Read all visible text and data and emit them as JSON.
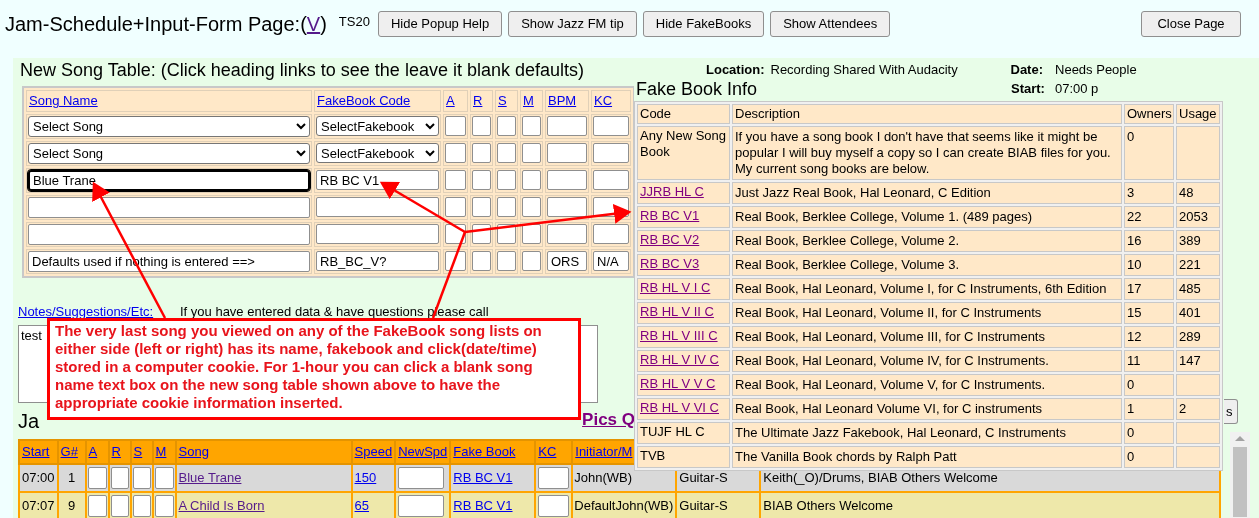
{
  "page": {
    "title": "Jam-Schedule+Input-Form Page:(",
    "title_link": "V",
    "title_end": ")",
    "version": "TS20"
  },
  "toolbar": {
    "buttons": [
      "Hide Popup Help",
      "Show Jazz FM tip",
      "Hide FakeBooks",
      "Show Attendees"
    ],
    "close_button": "Close Page"
  },
  "new_song_table": {
    "title": "New Song Table: (Click heading links to see the leave it blank defaults)",
    "columns": [
      "Song Name",
      "FakeBook Code",
      "A",
      "R",
      "S",
      "M",
      "BPM",
      "KC"
    ],
    "rows": [
      {
        "kind": "select",
        "song": "Select Song",
        "fakebook": "SelectFakebook",
        "focused": false
      },
      {
        "kind": "select",
        "song": "Select Song",
        "fakebook": "SelectFakebook",
        "focused": false
      },
      {
        "kind": "input",
        "song": "Blue Trane",
        "fakebook": "RB BC V1",
        "focused": true
      },
      {
        "kind": "input",
        "focused": false
      },
      {
        "kind": "input",
        "focused": false
      },
      {
        "kind": "input",
        "song": "Defaults used if nothing is entered ==>",
        "fakebook": "RB_BC_V?",
        "bpm": "ORS",
        "kc": "N/A",
        "focused": false
      }
    ]
  },
  "notes": {
    "link": "Notes/Suggestions/Etc:",
    "hint": "If you have entered data & have questions please call",
    "value": "test"
  },
  "popup_help": {
    "text": "The very last song you viewed on any of the FakeBook song lists on either side (left or right) has its name, fakebook and click(date/time) stored in a computer cookie. For 1-hour you can click a blank song name text box on the new song table shown above to have the appropriate cookie information inserted."
  },
  "schedule": {
    "heading": "Ja",
    "pics_link": "Pics Q",
    "partial_button": "s",
    "columns": [
      "Start",
      "G#",
      "A",
      "R",
      "S",
      "M",
      "Song",
      "Speed",
      "NewSpd",
      "Fake Book",
      "KC",
      "Initiator/M"
    ],
    "rows": [
      {
        "start": "07:00",
        "number": "1",
        "song": "Blue Trane",
        "speed": "150",
        "fake_book": "RB BC V1",
        "initiator": "John(WB)",
        "instrument": "Guitar-S",
        "notes": "Keith(_O)/Drums, BIAB Others Welcome",
        "color": "#d9d9d9"
      },
      {
        "start": "07:07",
        "number": "9",
        "song": "A Child Is Born",
        "speed": "65",
        "fake_book": "RB BC V1",
        "initiator": "DefaultJohn(WB)",
        "instrument": "Guitar-S",
        "notes": "BIAB Others Welcome",
        "color": "#eee8aa"
      }
    ]
  },
  "fake_book_info": {
    "location_label": "Location:",
    "location": "Recording Shared With Audacity",
    "date_label": "Date:",
    "date": "Needs People",
    "start_label": "Start:",
    "start": "07:00 p",
    "title": "Fake Book Info",
    "columns": [
      "Code",
      "Description",
      "Owners",
      "Usage"
    ],
    "rows": [
      {
        "code": "Any New Song Book",
        "link": false,
        "description": "If you have a song book I don't have that seems like it might be popular I will buy myself a copy so I can create BIAB files for you. My current song books are below.",
        "owners": "0"
      },
      {
        "code": "JJRB HL C",
        "link": true,
        "description": "Just Jazz Real Book, Hal Leonard, C Edition",
        "owners": "3",
        "usage": "48"
      },
      {
        "code": "RB BC V1",
        "link": true,
        "description": "Real Book, Berklee College, Volume 1. (489 pages)",
        "owners": "22",
        "usage": "2053"
      },
      {
        "code": "RB BC V2",
        "link": true,
        "description": "Real Book, Berklee College, Volume 2.",
        "owners": "16",
        "usage": "389"
      },
      {
        "code": "RB BC V3",
        "link": true,
        "description": "Real Book, Berklee College, Volume 3.",
        "owners": "10",
        "usage": "221"
      },
      {
        "code": "RB HL V I C",
        "link": true,
        "description": "Real Book, Hal Leonard, Volume I, for C Instruments, 6th Edition",
        "owners": "17",
        "usage": "485"
      },
      {
        "code": "RB HL V II C",
        "link": true,
        "description": "Real Book, Hal Leonard, Volume II, for C Instruments",
        "owners": "15",
        "usage": "401"
      },
      {
        "code": "RB HL V III C",
        "link": true,
        "description": "Real Book, Hal Leonard, Volume III, for C Instruments",
        "owners": "12",
        "usage": "289"
      },
      {
        "code": "RB HL V IV C",
        "link": true,
        "description": "Real Book, Hal Leonard, Volume IV, for C Instruments.",
        "owners": "11",
        "usage": "147"
      },
      {
        "code": "RB HL V V C",
        "link": true,
        "description": "Real Book, Hal Leonard, Volume V, for C Instruments.",
        "owners": "0"
      },
      {
        "code": "RB HL V VI C",
        "link": true,
        "description": "Real Book, Hal Leonard Volume VI, for C instruments",
        "owners": "1",
        "usage": "2"
      },
      {
        "code": "TUJF HL C",
        "link": false,
        "description": "The Ultimate Jazz Fakebook, Hal Leonard, C Instruments",
        "owners": "0"
      },
      {
        "code": "TVB",
        "link": false,
        "description": "The Vanilla Book chords by Ralph Patt",
        "owners": "0"
      }
    ]
  }
}
